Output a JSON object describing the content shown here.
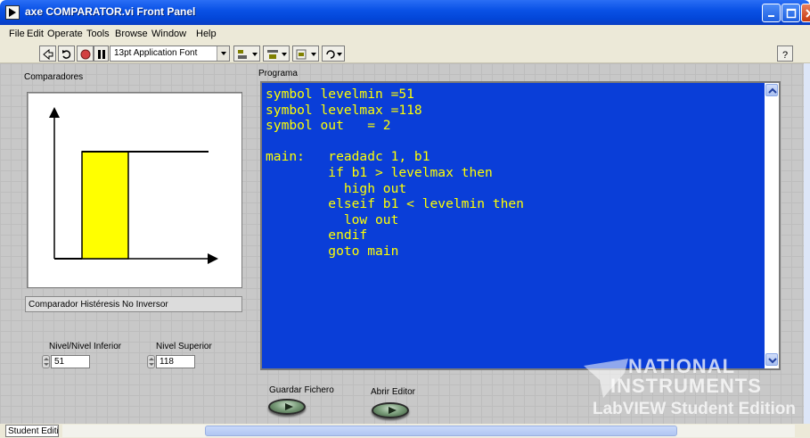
{
  "window": {
    "title": "axe COMPARATOR.vi Front Panel"
  },
  "menu": {
    "items": [
      "File",
      "Edit",
      "Operate",
      "Tools",
      "Browse",
      "Window",
      "Help"
    ]
  },
  "toolbar": {
    "font_label": "13pt Application Font"
  },
  "panel": {
    "comparadores_label": "Comparadores",
    "programa_label": "Programa",
    "comparator_type": "Comparador Histéresis No Inversor",
    "nivel_inferior_label": "Nivel/Nivel Inferior",
    "nivel_inferior_value": "51",
    "nivel_superior_label": "Nivel Superior",
    "nivel_superior_value": "118",
    "guardar_label": "Guardar Fichero",
    "abrir_label": "Abrir Editor"
  },
  "program_code": "symbol levelmin =51\nsymbol levelmax =118\nsymbol out   = 2\n\nmain:   readadc 1, b1\n        if b1 > levelmax then\n          high out\n        elseif b1 < levelmin then\n          low out\n        endif\n        goto main",
  "logo": {
    "line1": "NATIONAL",
    "line2": "INSTRUMENTS",
    "line3": "LabVIEW Student Edition"
  },
  "status": {
    "edition": "Student Edition"
  },
  "colors": {
    "title_bar": "#0a52e6",
    "code_bg": "#0a3ed8",
    "code_text": "#ffff00",
    "hysteresis_fill": "#ffff00"
  }
}
